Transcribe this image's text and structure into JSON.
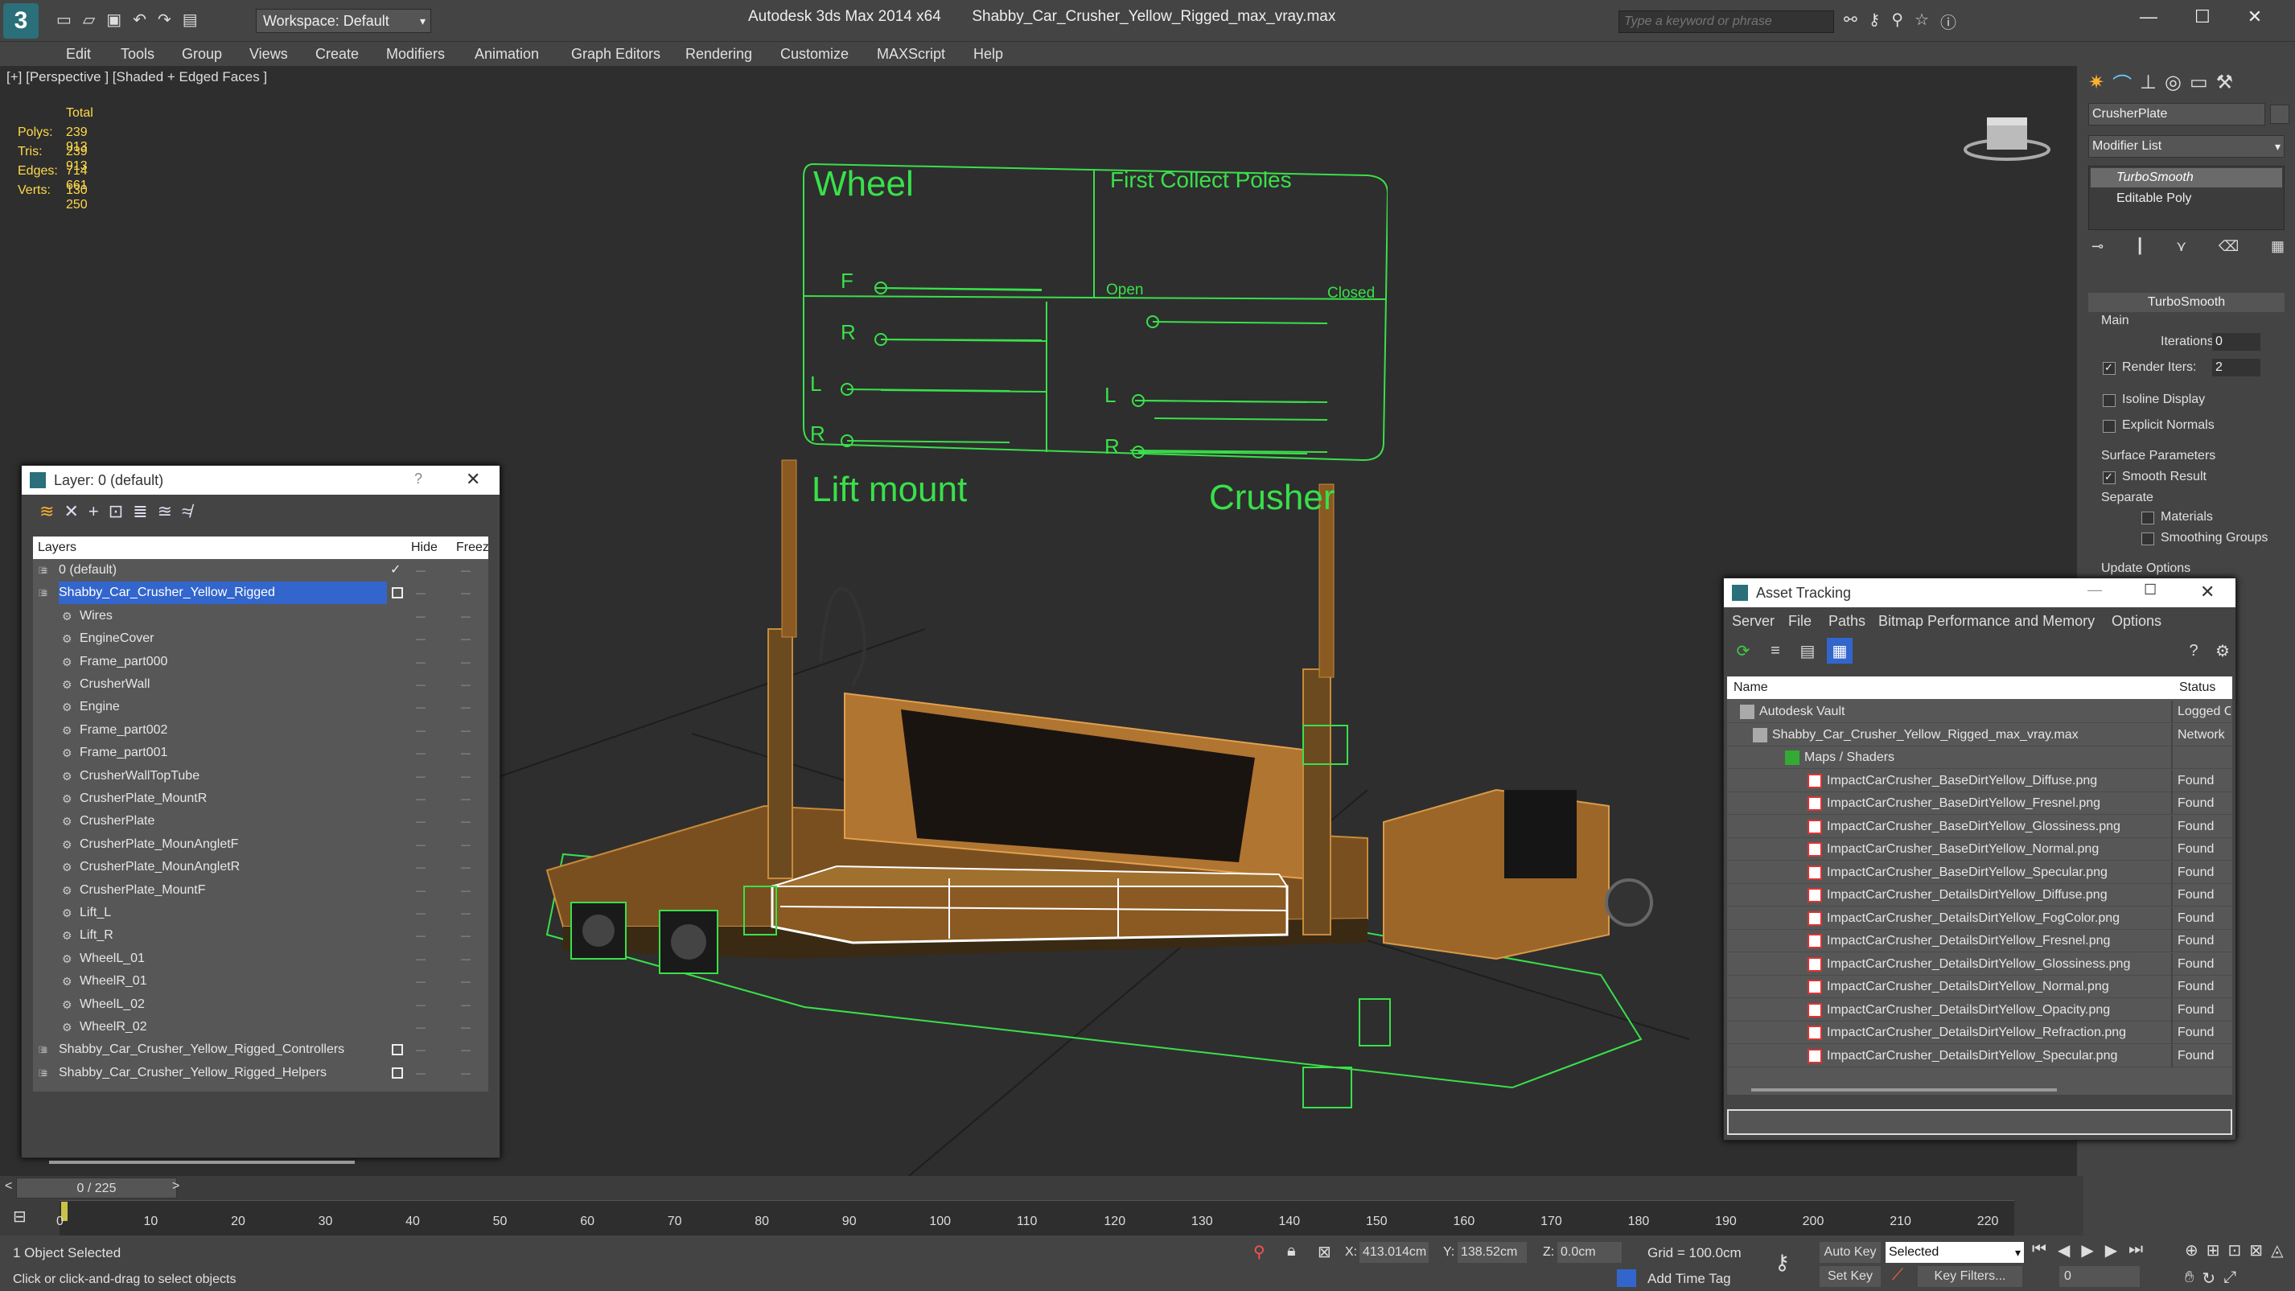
{
  "app": {
    "title": "Autodesk 3ds Max  2014 x64",
    "file": "Shabby_Car_Crusher_Yellow_Rigged_max_vray.max",
    "workspace": "Workspace: Default",
    "search_placeholder": "Type a keyword or phrase"
  },
  "menu": [
    "Edit",
    "Tools",
    "Group",
    "Views",
    "Create",
    "Modifiers",
    "Animation",
    "Graph Editors",
    "Rendering",
    "Customize",
    "MAXScript",
    "Help"
  ],
  "viewport": {
    "label": "[+] [Perspective ] [Shaded + Edged Faces ]",
    "stats": {
      "header": "Total",
      "rows": [
        {
          "k": "Polys:",
          "v": "239 913"
        },
        {
          "k": "Tris:",
          "v": "239 913"
        },
        {
          "k": "Edges:",
          "v": "714 661"
        },
        {
          "k": "Verts:",
          "v": "130 250"
        }
      ]
    },
    "controls": {
      "wheel": "Wheel",
      "f": "F",
      "r": "R",
      "first_collect_poles": "First Collect Poles",
      "open": "Open",
      "closed": "Closed",
      "l": "L",
      "lift_mount": "Lift mount",
      "crusher": "Crusher"
    }
  },
  "command_panel": {
    "object_name": "CrusherPlate",
    "modifier_list": "Modifier List",
    "stack": [
      "TurboSmooth",
      "Editable Poly"
    ],
    "rollout": "TurboSmooth",
    "main": "Main",
    "iterations_label": "Iterations:",
    "iterations": "0",
    "render_iters_label": "Render Iters:",
    "render_iters": "2",
    "isoline": "Isoline Display",
    "explicit_normals": "Explicit Normals",
    "surface_params": "Surface Parameters",
    "smooth_result": "Smooth Result",
    "separate": "Separate",
    "materials": "Materials",
    "smoothing_groups": "Smoothing Groups",
    "update_options": "Update Options"
  },
  "layer_dialog": {
    "title": "Layer: 0 (default)",
    "col_layers": "Layers",
    "col_hide": "Hide",
    "col_freeze": "Freez",
    "rows": [
      {
        "name": "0 (default)",
        "level": 0
      },
      {
        "name": "Shabby_Car_Crusher_Yellow_Rigged",
        "level": 0,
        "selected": true
      },
      {
        "name": "Wires",
        "level": 1
      },
      {
        "name": "EngineCover",
        "level": 1
      },
      {
        "name": "Frame_part000",
        "level": 1
      },
      {
        "name": "CrusherWall",
        "level": 1
      },
      {
        "name": "Engine",
        "level": 1
      },
      {
        "name": "Frame_part002",
        "level": 1
      },
      {
        "name": "Frame_part001",
        "level": 1
      },
      {
        "name": "CrusherWallTopTube",
        "level": 1
      },
      {
        "name": "CrusherPlate_MountR",
        "level": 1
      },
      {
        "name": "CrusherPlate",
        "level": 1
      },
      {
        "name": "CrusherPlate_MounAngletF",
        "level": 1
      },
      {
        "name": "CrusherPlate_MounAngletR",
        "level": 1
      },
      {
        "name": "CrusherPlate_MountF",
        "level": 1
      },
      {
        "name": "Lift_L",
        "level": 1
      },
      {
        "name": "Lift_R",
        "level": 1
      },
      {
        "name": "WheelL_01",
        "level": 1
      },
      {
        "name": "WheelR_01",
        "level": 1
      },
      {
        "name": "WheelL_02",
        "level": 1
      },
      {
        "name": "WheelR_02",
        "level": 1
      },
      {
        "name": "Shabby_Car_Crusher_Yellow_Rigged_Controllers",
        "level": 0
      },
      {
        "name": "Shabby_Car_Crusher_Yellow_Rigged_Helpers",
        "level": 0
      }
    ]
  },
  "asset_dialog": {
    "title": "Asset Tracking",
    "menu": [
      "Server",
      "File",
      "Paths",
      "Bitmap Performance and Memory",
      "Options"
    ],
    "col_name": "Name",
    "col_status": "Status",
    "rows": [
      {
        "name": "Autodesk Vault",
        "status": "Logged O",
        "level": 0
      },
      {
        "name": "Shabby_Car_Crusher_Yellow_Rigged_max_vray.max",
        "status": "Network",
        "level": 1
      },
      {
        "name": "Maps / Shaders",
        "status": "",
        "level": 2
      },
      {
        "name": "ImpactCarCrusher_BaseDirtYellow_Diffuse.png",
        "status": "Found",
        "level": 3
      },
      {
        "name": "ImpactCarCrusher_BaseDirtYellow_Fresnel.png",
        "status": "Found",
        "level": 3
      },
      {
        "name": "ImpactCarCrusher_BaseDirtYellow_Glossiness.png",
        "status": "Found",
        "level": 3
      },
      {
        "name": "ImpactCarCrusher_BaseDirtYellow_Normal.png",
        "status": "Found",
        "level": 3
      },
      {
        "name": "ImpactCarCrusher_BaseDirtYellow_Specular.png",
        "status": "Found",
        "level": 3
      },
      {
        "name": "ImpactCarCrusher_DetailsDirtYellow_Diffuse.png",
        "status": "Found",
        "level": 3
      },
      {
        "name": "ImpactCarCrusher_DetailsDirtYellow_FogColor.png",
        "status": "Found",
        "level": 3
      },
      {
        "name": "ImpactCarCrusher_DetailsDirtYellow_Fresnel.png",
        "status": "Found",
        "level": 3
      },
      {
        "name": "ImpactCarCrusher_DetailsDirtYellow_Glossiness.png",
        "status": "Found",
        "level": 3
      },
      {
        "name": "ImpactCarCrusher_DetailsDirtYellow_Normal.png",
        "status": "Found",
        "level": 3
      },
      {
        "name": "ImpactCarCrusher_DetailsDirtYellow_Opacity.png",
        "status": "Found",
        "level": 3
      },
      {
        "name": "ImpactCarCrusher_DetailsDirtYellow_Refraction.png",
        "status": "Found",
        "level": 3
      },
      {
        "name": "ImpactCarCrusher_DetailsDirtYellow_Specular.png",
        "status": "Found",
        "level": 3
      }
    ]
  },
  "timeline": {
    "frame": "0 / 225",
    "ticks": [
      "0",
      "10",
      "20",
      "30",
      "40",
      "50",
      "60",
      "70",
      "80",
      "90",
      "100",
      "110",
      "120",
      "130",
      "140",
      "150",
      "160",
      "170",
      "180",
      "190",
      "200",
      "210",
      "220"
    ]
  },
  "status": {
    "selected": "1 Object Selected",
    "prompt": "Click or click-and-drag to select objects",
    "x_label": "X:",
    "x": "413.014cm",
    "y_label": "Y:",
    "y": "138.52cm",
    "z_label": "Z:",
    "z": "0.0cm",
    "grid": "Grid = 100.0cm",
    "add_time_tag": "Add Time Tag",
    "auto_key": "Auto Key",
    "set_key": "Set Key",
    "selected_dropdown": "Selected",
    "key_filters": "Key Filters...",
    "frame_field": "0"
  },
  "colors": {
    "accent": "#3366cc",
    "wire": "#39e04a",
    "yellow": "#ffd94a",
    "model": "#c88a3a"
  }
}
